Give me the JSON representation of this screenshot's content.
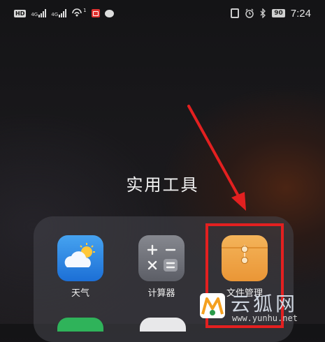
{
  "status_bar": {
    "hd_badge": "HD",
    "network_1": "4G",
    "network_2": "4G",
    "notification_count": "1",
    "battery": "90",
    "time": "7:24"
  },
  "folder": {
    "title": "实用工具",
    "apps": [
      {
        "label": "天气",
        "icon": "weather-icon"
      },
      {
        "label": "计算器",
        "icon": "calculator-icon"
      },
      {
        "label": "文件管理",
        "icon": "file-manager-icon"
      }
    ]
  },
  "annotation": {
    "highlight_color": "#e32020"
  },
  "watermark": {
    "brand": "云狐网",
    "url": "www.yunhu.net"
  }
}
